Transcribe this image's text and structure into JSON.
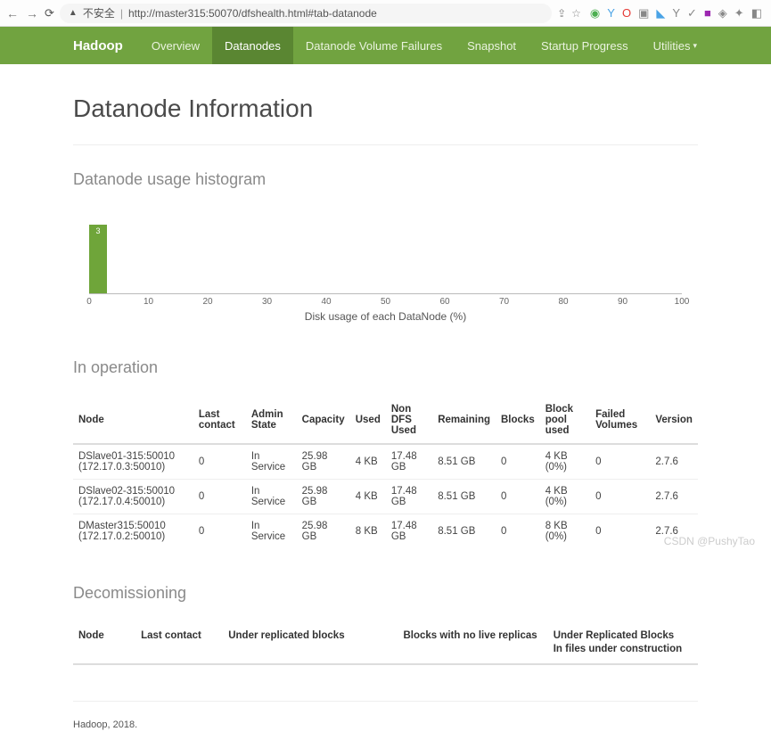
{
  "browser": {
    "security_label": "不安全",
    "url": "http://master315:50070/dfshealth.html#tab-datanode"
  },
  "nav": {
    "brand": "Hadoop",
    "items": [
      "Overview",
      "Datanodes",
      "Datanode Volume Failures",
      "Snapshot",
      "Startup Progress",
      "Utilities"
    ],
    "active_index": 1
  },
  "page_title": "Datanode Information",
  "histogram": {
    "title": "Datanode usage histogram",
    "axis_label": "Disk usage of each DataNode (%)",
    "bar_value": "3",
    "ticks": [
      "0",
      "10",
      "20",
      "30",
      "40",
      "50",
      "60",
      "70",
      "80",
      "90",
      "100"
    ]
  },
  "in_operation": {
    "title": "In operation",
    "columns": [
      "Node",
      "Last contact",
      "Admin State",
      "Capacity",
      "Used",
      "Non DFS Used",
      "Remaining",
      "Blocks",
      "Block pool used",
      "Failed Volumes",
      "Version"
    ],
    "rows": [
      [
        "DSlave01-315:50010 (172.17.0.3:50010)",
        "0",
        "In Service",
        "25.98 GB",
        "4 KB",
        "17.48 GB",
        "8.51 GB",
        "0",
        "4 KB (0%)",
        "0",
        "2.7.6"
      ],
      [
        "DSlave02-315:50010 (172.17.0.4:50010)",
        "0",
        "In Service",
        "25.98 GB",
        "4 KB",
        "17.48 GB",
        "8.51 GB",
        "0",
        "4 KB (0%)",
        "0",
        "2.7.6"
      ],
      [
        "DMaster315:50010 (172.17.0.2:50010)",
        "0",
        "In Service",
        "25.98 GB",
        "8 KB",
        "17.48 GB",
        "8.51 GB",
        "0",
        "8 KB (0%)",
        "0",
        "2.7.6"
      ]
    ]
  },
  "decom": {
    "title": "Decomissioning",
    "columns": [
      "Node",
      "Last contact",
      "Under replicated blocks",
      "Blocks with no live replicas",
      "Under Replicated Blocks\nIn files under construction"
    ]
  },
  "footer": "Hadoop, 2018.",
  "watermark": "CSDN @PushyTao",
  "chart_data": {
    "type": "bar",
    "title": "Datanode usage histogram",
    "xlabel": "Disk usage of each DataNode (%)",
    "ylabel": "",
    "categories": [
      "0-10"
    ],
    "values": [
      3
    ],
    "xlim": [
      0,
      100
    ]
  }
}
